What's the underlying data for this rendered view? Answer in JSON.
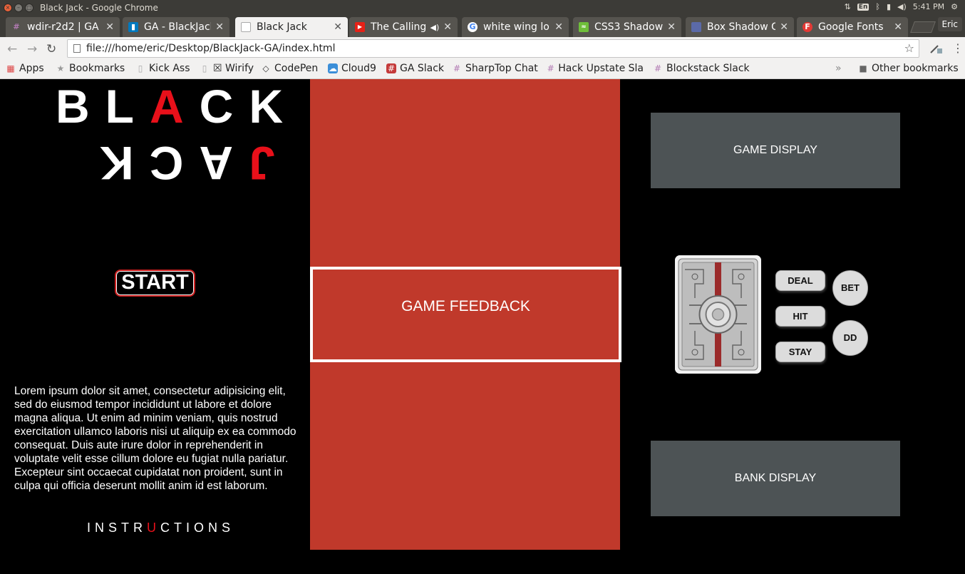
{
  "os": {
    "window_title": "Black Jack - Google Chrome",
    "lang": "En",
    "time": "5:41 PM",
    "user": "Eric"
  },
  "tabs": [
    {
      "title": "wdir-r2d2 | GA",
      "icon": "slack-hash-icon",
      "color": "#7c3a7d"
    },
    {
      "title": "GA - BlackJack",
      "icon": "trello-icon",
      "color": "#0079bf"
    },
    {
      "title": "Black Jack",
      "icon": "page-icon",
      "color": "#9e9e9e"
    },
    {
      "title": "The Calling",
      "icon": "youtube-icon",
      "color": "#e62117"
    },
    {
      "title": "white wing lo",
      "icon": "google-icon",
      "color": "#4285f4"
    },
    {
      "title": "CSS3 Shadow",
      "icon": "css3-shadow-icon",
      "color": "#6fbf3a"
    },
    {
      "title": "Box Shadow G",
      "icon": "box-shadow-icon",
      "color": "#5b6aa8"
    },
    {
      "title": "Google Fonts",
      "icon": "google-fonts-icon",
      "color": "#e53935"
    }
  ],
  "address": {
    "url": "file:///home/eric/Desktop/BlackJack-GA/index.html"
  },
  "bookmarks": {
    "apps": "Apps",
    "items": [
      "Bookmarks",
      "Kick Ass",
      "☒ Wirify",
      "CodePen",
      "Cloud9",
      "GA Slack",
      "SharpTop Chat",
      "Hack Upstate Sla",
      "Blockstack Slack"
    ],
    "other": "Other bookmarks"
  },
  "game": {
    "logo_top": "BLACK",
    "logo_bottom": "JACK",
    "start_label": "START",
    "lorem": "Lorem ipsum dolor sit amet, consectetur adipisicing elit, sed do eiusmod tempor incididunt ut labore et dolore magna aliqua. Ut enim ad minim veniam, quis nostrud exercitation ullamco laboris nisi ut aliquip ex ea commodo consequat. Duis aute irure dolor in reprehenderit in voluptate velit esse cillum dolore eu fugiat nulla pariatur. Excepteur sint occaecat cupidatat non proident, sunt in culpa qui officia deserunt mollit anim id est laborum.",
    "instructions": "INSTRUCTIONS",
    "game_feedback": "GAME FEEDBACK",
    "game_display": "GAME DISPLAY",
    "bank_display": "BANK DISPLAY",
    "buttons": {
      "deal": "DEAL",
      "hit": "HIT",
      "stay": "STAY",
      "bet": "BET",
      "dd": "DD"
    },
    "colors": {
      "accent_red": "#e8101a",
      "center_column": "#c0392b",
      "display_panel": "#4d5355"
    }
  }
}
